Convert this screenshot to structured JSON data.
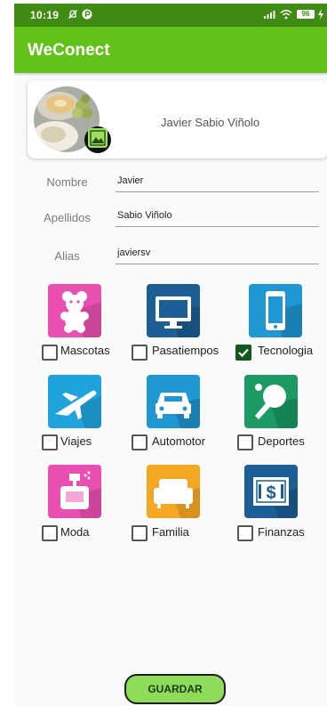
{
  "status_bar": {
    "time": "10:19",
    "battery": "96"
  },
  "app_bar": {
    "title": "WeConect"
  },
  "profile": {
    "name": "Javier Sabio Viñolo"
  },
  "form": {
    "nombre_label": "Nombre",
    "nombre_value": "Javier",
    "apellidos_label": "Apellidos",
    "apellidos_value": "Sabio Viñolo",
    "alias_label": "Alias",
    "alias_value": "javiersv"
  },
  "categories": [
    {
      "label": "Mascotas",
      "checked": false,
      "icon": "teddy-bear-icon",
      "color": "#e84fb0"
    },
    {
      "label": "Pasatiempos",
      "checked": false,
      "icon": "television-icon",
      "color": "#1c5e96"
    },
    {
      "label": "Tecnologia",
      "checked": true,
      "icon": "smartphone-icon",
      "color": "#1f97d3"
    },
    {
      "label": "Viajes",
      "checked": false,
      "icon": "airplane-icon",
      "color": "#1fa3dc"
    },
    {
      "label": "Automotor",
      "checked": false,
      "icon": "car-icon",
      "color": "#1f97d3"
    },
    {
      "label": "Deportes",
      "checked": false,
      "icon": "ping-pong-icon",
      "color": "#1b9a63"
    },
    {
      "label": "Moda",
      "checked": false,
      "icon": "perfume-icon",
      "color": "#e84fb0"
    },
    {
      "label": "Familia",
      "checked": false,
      "icon": "sofa-icon",
      "color": "#f4a722"
    },
    {
      "label": "Finanzas",
      "checked": false,
      "icon": "dollar-bill-icon",
      "color": "#1c5e96"
    }
  ],
  "save_button": {
    "label": "GUARDAR"
  },
  "colors": {
    "status_bar": "#3f8b13",
    "app_bar": "#62c21a",
    "button": "#8fdc58",
    "checkbox_checked": "#10591b"
  }
}
